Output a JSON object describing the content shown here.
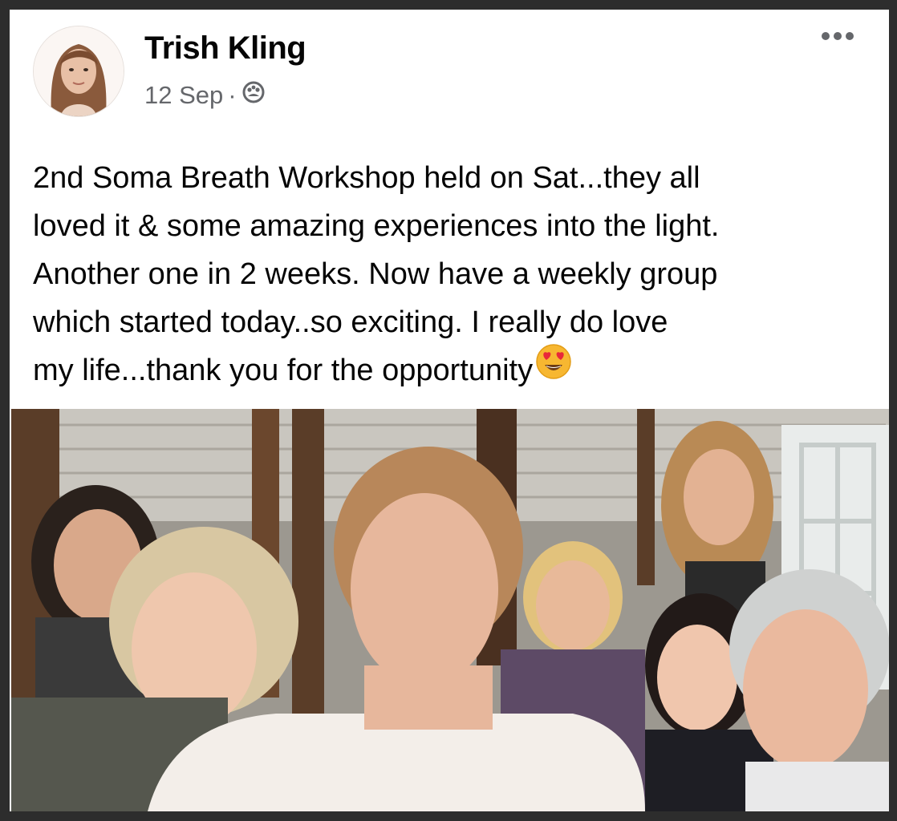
{
  "post": {
    "author": "Trish Kling",
    "date": "12 Sep",
    "separator": "·",
    "audience_icon": "friends-icon",
    "text": "2nd Soma Breath Workshop held on Sat...they all\nloved it & some amazing experiences into the light.\nAnother one in 2 weeks.  Now have a weekly group\nwhich started today..so exciting.  I really do love\nmy life...thank you for the opportunity",
    "emoji": "heart-eyes-emoji",
    "photo": "group-selfie-photo"
  },
  "colors": {
    "name": "#050505",
    "meta": "#65676b",
    "background": "#ffffff",
    "frame": "#2d2d2d",
    "emoji_yellow": "#f7b731"
  }
}
